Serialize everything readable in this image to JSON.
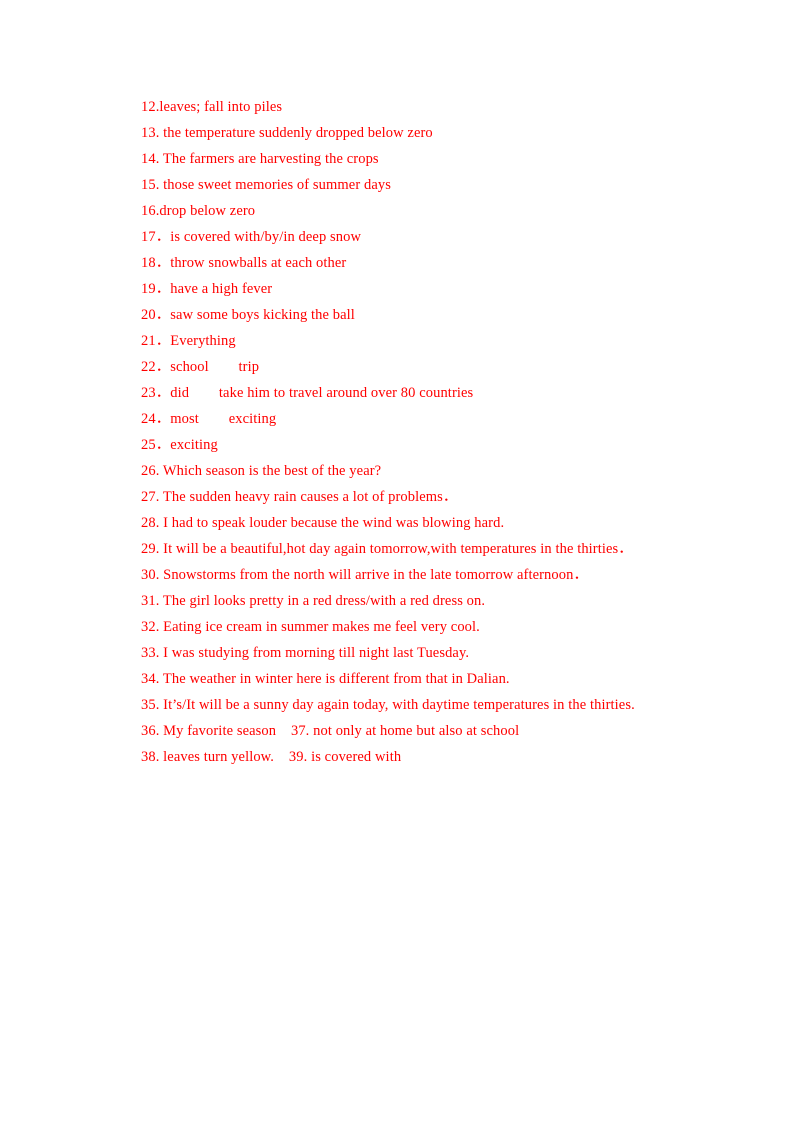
{
  "document": {
    "type": "answer-key",
    "text_color": "#ff0000",
    "background_color": "#ffffff",
    "lines": [
      {
        "num": "12",
        "text": "12.leaves; fall into piles"
      },
      {
        "num": "13",
        "text": "13. the temperature suddenly dropped below zero"
      },
      {
        "num": "14",
        "text": "14. The farmers are harvesting the crops"
      },
      {
        "num": "15",
        "text": "15. those sweet memories of summer days"
      },
      {
        "num": "16",
        "text": "16.drop below zero"
      },
      {
        "num": "17",
        "text": "17．is covered with/by/in deep snow"
      },
      {
        "num": "18",
        "text": "18．throw snowballs at each other"
      },
      {
        "num": "19",
        "text": "19．have a high fever"
      },
      {
        "num": "20",
        "text": "20．saw some boys kicking the ball"
      },
      {
        "num": "21",
        "text": "21．Everything"
      },
      {
        "num": "22",
        "text": "22．school        trip"
      },
      {
        "num": "23",
        "text": "23．did        take him to travel around over 80 countries"
      },
      {
        "num": "24",
        "text": "24．most        exciting"
      },
      {
        "num": "25",
        "text": "25．exciting"
      },
      {
        "num": "26",
        "text": "26. Which season is the best of the year?"
      },
      {
        "num": "27",
        "text": "27. The sudden heavy rain causes a lot of problems．"
      },
      {
        "num": "28",
        "text": "28. I had to speak louder because the wind was blowing hard."
      },
      {
        "num": "29",
        "text": "29. It will be a beautiful,hot day again tomorrow,with temperatures in the thirties．"
      },
      {
        "num": "30",
        "text": "30. Snowstorms from the north will arrive in the late tomorrow afternoon．"
      },
      {
        "num": "31",
        "text": "31. The girl looks pretty in a red dress/with a red dress on."
      },
      {
        "num": "32",
        "text": "32. Eating ice cream in summer makes me feel very cool."
      },
      {
        "num": "33",
        "text": "33. I was studying from morning till night last Tuesday."
      },
      {
        "num": "34",
        "text": "34. The weather in winter here is different from that in Dalian."
      },
      {
        "num": "35",
        "text": "35. It’s/It will be a sunny day again today, with daytime temperatures in the thirties."
      },
      {
        "num": "36",
        "text": "36. My favorite season    37. not only at home but also at school"
      },
      {
        "num": "38",
        "text": "38. leaves turn yellow.    39. is covered with"
      }
    ]
  }
}
